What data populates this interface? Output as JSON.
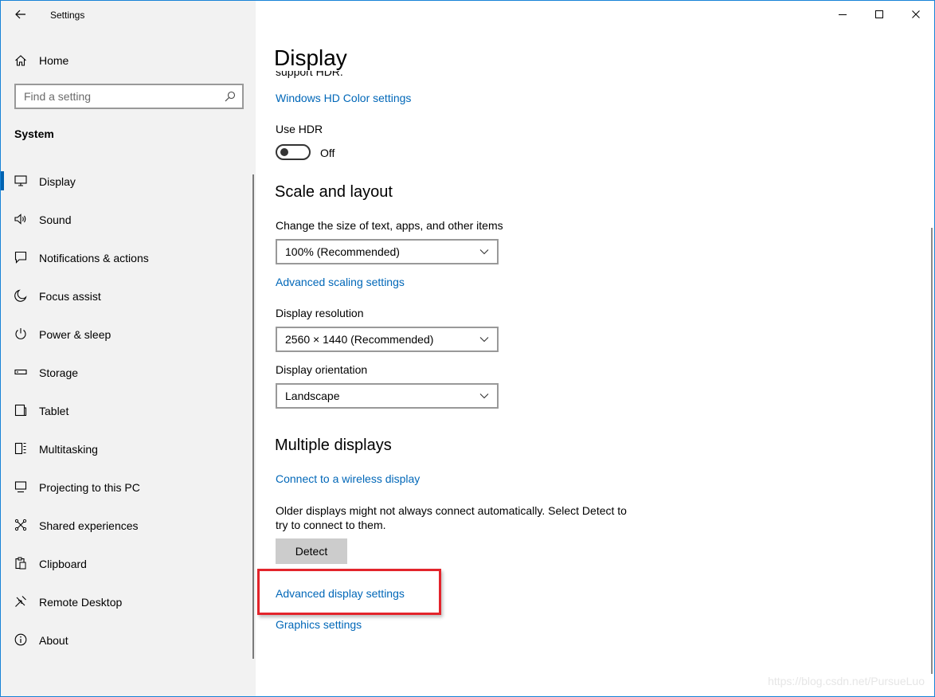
{
  "app": {
    "title": "Settings"
  },
  "sidebar": {
    "home_label": "Home",
    "search_placeholder": "Find a setting",
    "section": "System",
    "items": [
      {
        "label": "Display",
        "icon": "monitor-icon",
        "active": true
      },
      {
        "label": "Sound",
        "icon": "speaker-icon"
      },
      {
        "label": "Notifications & actions",
        "icon": "notifications-icon"
      },
      {
        "label": "Focus assist",
        "icon": "moon-icon"
      },
      {
        "label": "Power & sleep",
        "icon": "power-icon"
      },
      {
        "label": "Storage",
        "icon": "storage-icon"
      },
      {
        "label": "Tablet",
        "icon": "tablet-icon"
      },
      {
        "label": "Multitasking",
        "icon": "multitasking-icon"
      },
      {
        "label": "Projecting to this PC",
        "icon": "projecting-icon"
      },
      {
        "label": "Shared experiences",
        "icon": "shared-experiences-icon"
      },
      {
        "label": "Clipboard",
        "icon": "clipboard-icon"
      },
      {
        "label": "Remote Desktop",
        "icon": "remote-desktop-icon"
      },
      {
        "label": "About",
        "icon": "info-icon"
      }
    ]
  },
  "main": {
    "title": "Display",
    "cut_text": "support HDR.",
    "hdr_color_link": "Windows HD Color settings",
    "use_hdr_label": "Use HDR",
    "hdr_toggle_state": "Off",
    "scale_heading": "Scale and layout",
    "scale_label": "Change the size of text, apps, and other items",
    "scale_value": "100% (Recommended)",
    "advanced_scaling_link": "Advanced scaling settings",
    "resolution_label": "Display resolution",
    "resolution_value": "2560 × 1440 (Recommended)",
    "orientation_label": "Display orientation",
    "orientation_value": "Landscape",
    "multiple_heading": "Multiple displays",
    "wireless_link": "Connect to a wireless display",
    "detect_text": "Older displays might not always connect automatically. Select Detect to try to connect to them.",
    "detect_button": "Detect",
    "advanced_display_link": "Advanced display settings",
    "graphics_link": "Graphics settings"
  },
  "watermark": "https://blog.csdn.net/PursueLuo",
  "colors": {
    "accent": "#0063b1",
    "link": "#0067b8",
    "highlight": "#e3242b",
    "sidebar_bg": "#f2f2f2"
  }
}
